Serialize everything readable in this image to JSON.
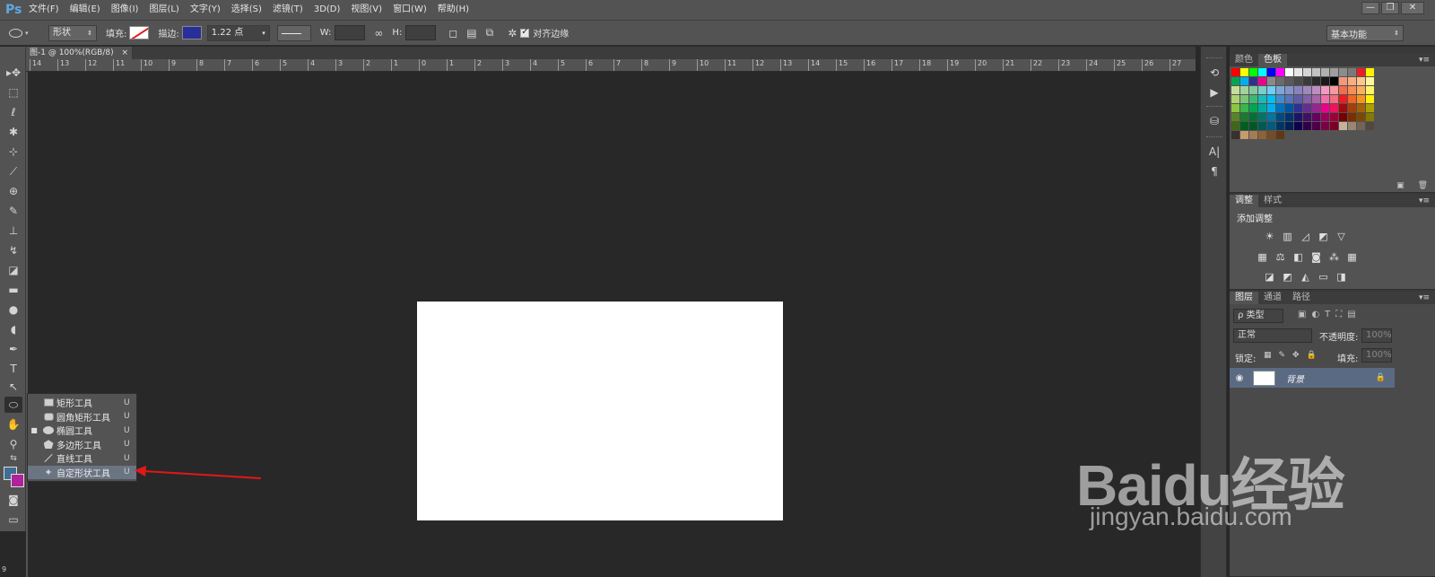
{
  "app": {
    "logo": "Ps"
  },
  "menu": [
    "文件(F)",
    "编辑(E)",
    "图像(I)",
    "图层(L)",
    "文字(Y)",
    "选择(S)",
    "滤镜(T)",
    "3D(D)",
    "视图(V)",
    "窗口(W)",
    "帮助(H)"
  ],
  "window_controls": {
    "minimize": "—",
    "restore": "❐",
    "close": "✕"
  },
  "options": {
    "mode": "形状",
    "fill_label": "填充:",
    "stroke_label": "描边:",
    "stroke_width": "1.22 点",
    "w_label": "W:",
    "h_label": "H:",
    "align_edges": "对齐边缘",
    "workspace": "基本功能"
  },
  "document": {
    "tab_title": "图-1 @ 100%(RGB/8)",
    "tab_close": "×"
  },
  "ruler_numbers": [
    "14",
    "13",
    "12",
    "11",
    "10",
    "9",
    "8",
    "7",
    "6",
    "5",
    "4",
    "3",
    "2",
    "1",
    "0",
    "1",
    "2",
    "3",
    "4",
    "5",
    "6",
    "7",
    "8",
    "9",
    "10",
    "11",
    "12",
    "13",
    "14",
    "15",
    "16",
    "17",
    "18",
    "19",
    "20",
    "21",
    "22",
    "23",
    "24",
    "25",
    "26",
    "27"
  ],
  "flyout": [
    {
      "label": "矩形工具",
      "key": "U",
      "icon": "rectangle-icon",
      "active": false
    },
    {
      "label": "圆角矩形工具",
      "key": "U",
      "icon": "rounded-rectangle-icon",
      "active": false
    },
    {
      "label": "椭圆工具",
      "key": "U",
      "icon": "ellipse-icon",
      "active": true
    },
    {
      "label": "多边形工具",
      "key": "U",
      "icon": "polygon-icon",
      "active": false
    },
    {
      "label": "直线工具",
      "key": "U",
      "icon": "line-icon",
      "active": false
    },
    {
      "label": "自定形状工具",
      "key": "U",
      "icon": "custom-shape-icon",
      "active": false
    }
  ],
  "panels": {
    "swatches_tabs": [
      "颜色",
      "色板"
    ],
    "adjust_tabs": [
      "调整",
      "样式"
    ],
    "adjust_title": "添加调整",
    "layers_tabs": [
      "图层",
      "通道",
      "路径"
    ],
    "layer_filter": "ρ 类型",
    "blend_mode": "正常",
    "opacity_label": "不透明度:",
    "opacity_value": "100%",
    "lock_label": "锁定:",
    "fill_label": "填充:",
    "fill_value": "100%",
    "layer_name": "背景"
  },
  "watermark": {
    "brand": "Baidu经验",
    "url": "jingyan.baidu.com"
  },
  "colors": {
    "accent_arrow": "#e01818",
    "foreground": "#3f6d93",
    "background": "#b0239b",
    "stroke_swatch": "#282f9a"
  },
  "status": {
    "page_number": "9"
  }
}
